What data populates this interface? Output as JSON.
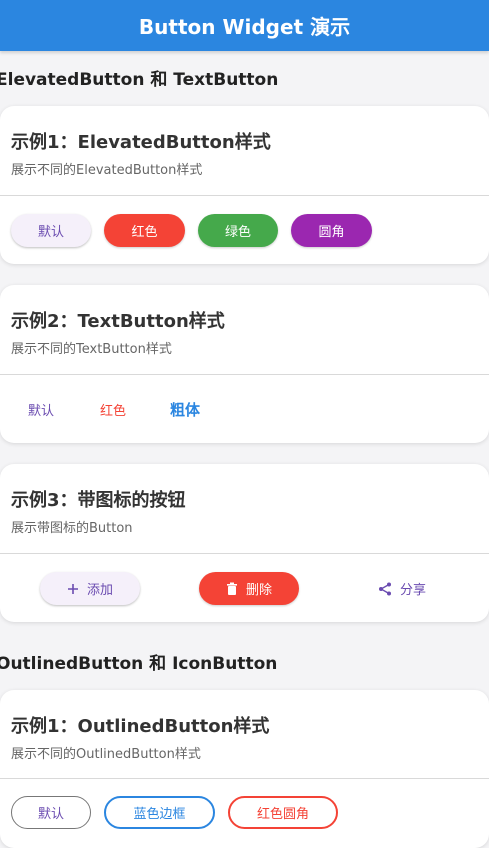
{
  "appbar": {
    "title": "Button Widget 演示"
  },
  "sections": [
    {
      "title": "ElevatedButton 和 TextButton"
    },
    {
      "title": "OutlinedButton 和 IconButton"
    }
  ],
  "cards": [
    {
      "title": "示例1：ElevatedButton样式",
      "subtitle": "展示不同的ElevatedButton样式",
      "buttons": [
        "默认",
        "红色",
        "绿色",
        "圆角"
      ]
    },
    {
      "title": "示例2：TextButton样式",
      "subtitle": "展示不同的TextButton样式",
      "buttons": [
        "默认",
        "红色",
        "粗体"
      ]
    },
    {
      "title": "示例3：带图标的按钮",
      "subtitle": "展示带图标的Button",
      "buttons": [
        "添加",
        "删除",
        "分享"
      ]
    },
    {
      "title": "示例1：OutlinedButton样式",
      "subtitle": "展示不同的OutlinedButton样式",
      "buttons": [
        "默认",
        "蓝色边框",
        "红色圆角"
      ]
    }
  ],
  "colors": {
    "appbar": "#2b86e0",
    "red": "#f44336",
    "green": "#45a94b",
    "purple": "#9b27b0",
    "blue": "#2b86e0",
    "primary_text": "#6a4bb0"
  },
  "icons": {
    "add": "plus-icon",
    "delete": "trash-icon",
    "share": "share-icon"
  }
}
